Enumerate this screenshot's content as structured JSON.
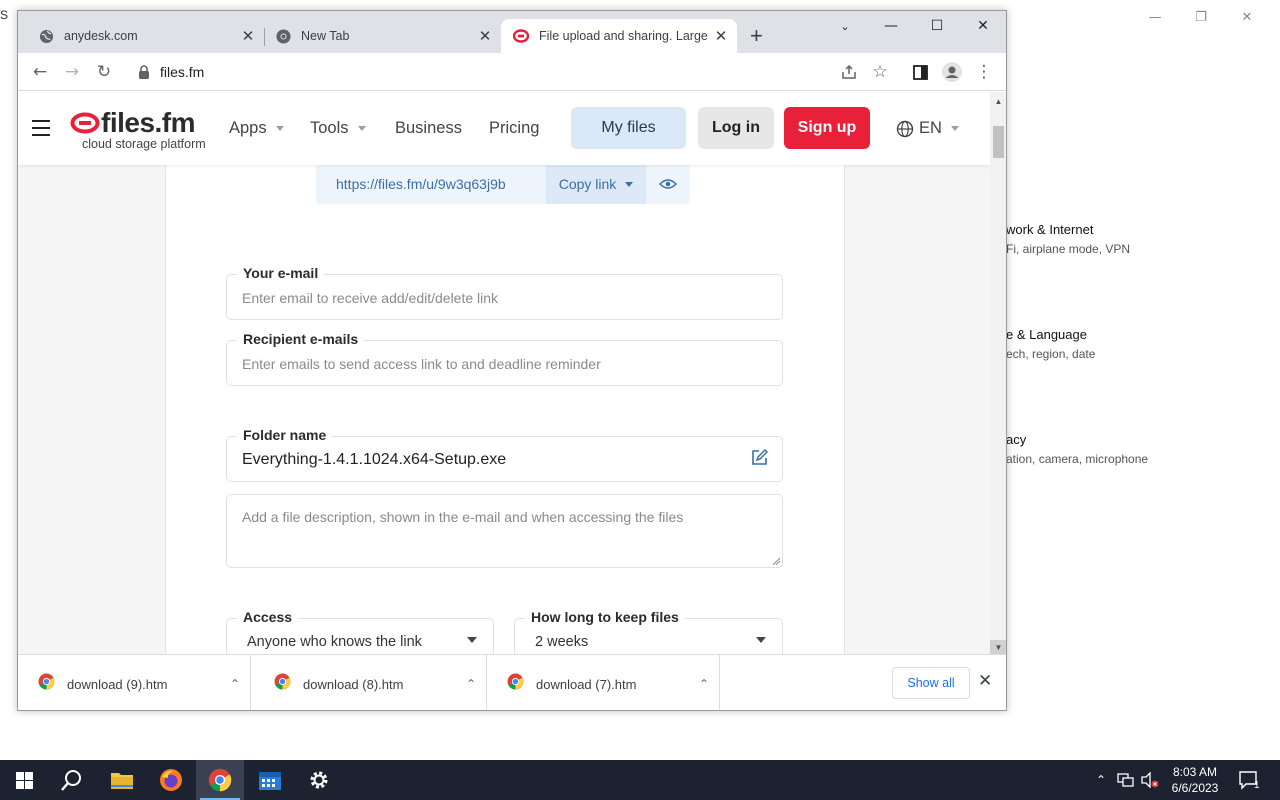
{
  "desktop": {
    "bg_window": {
      "partial_letter": "S",
      "categories": [
        {
          "title": "work & Internet",
          "subtitle": "Fi, airplane mode, VPN"
        },
        {
          "title": "e & Language",
          "subtitle": "ech, region, date"
        },
        {
          "title": "acy",
          "subtitle": "ation, camera, microphone"
        }
      ]
    }
  },
  "browser": {
    "tabs": [
      {
        "title": "anydesk.com"
      },
      {
        "title": "New Tab"
      },
      {
        "title": "File upload and sharing. Large fil"
      }
    ],
    "url": "files.fm"
  },
  "site": {
    "logo_name": "files.fm",
    "logo_tagline": "cloud storage platform",
    "nav": {
      "apps": "Apps",
      "tools": "Tools",
      "business": "Business",
      "pricing": "Pricing"
    },
    "my_files": "My files",
    "login": "Log in",
    "signup": "Sign up",
    "lang": "EN"
  },
  "form": {
    "share_link": "https://files.fm/u/9w3q63j9b",
    "copy_link": "Copy link",
    "email": {
      "label": "Your e-mail",
      "placeholder": "Enter email to receive add/edit/delete link"
    },
    "recipients": {
      "label": "Recipient e-mails",
      "placeholder": "Enter emails to send access link to and deadline reminder"
    },
    "folder": {
      "label": "Folder name",
      "value": "Everything-1.4.1.1024.x64-Setup.exe"
    },
    "description": {
      "placeholder": "Add a file description, shown in the e-mail and when accessing the files"
    },
    "access": {
      "label": "Access",
      "value": "Anyone who knows the link"
    },
    "keep": {
      "label": "How long to keep files",
      "value": "2 weeks"
    }
  },
  "downloads": {
    "items": [
      {
        "name": "download (9).htm"
      },
      {
        "name": "download (8).htm"
      },
      {
        "name": "download (7).htm"
      }
    ],
    "show_all": "Show all"
  },
  "taskbar": {
    "time": "8:03 AM",
    "date": "6/6/2023",
    "notifications": "1"
  },
  "colors": {
    "brand_red": "#e8203a",
    "accent_blue": "#3a6fa8",
    "taskbar": "#1c2230"
  }
}
